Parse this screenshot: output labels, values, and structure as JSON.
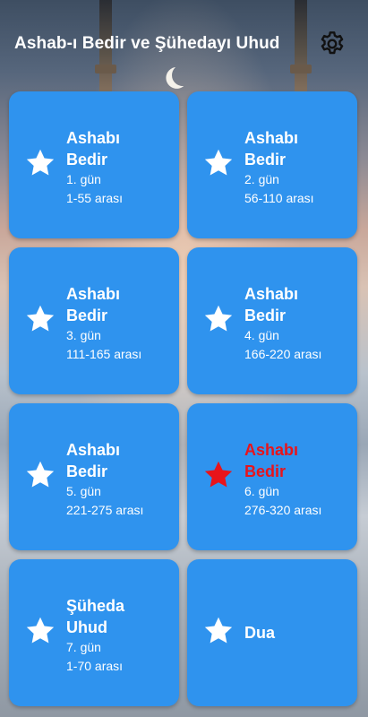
{
  "header": {
    "title": "Ashab-ı Bedir ve Şühedayı Uhud",
    "settings_icon": "gear-icon"
  },
  "colors": {
    "card": "#2f93ee",
    "star_default": "#ffffff",
    "star_active": "#e8141b",
    "text": "#ffffff"
  },
  "cards": [
    {
      "name": "Ashabı\nBedir",
      "day": "1. gün",
      "range": "1-55 arası",
      "icon": "star-icon",
      "active": false
    },
    {
      "name": "Ashabı\nBedir",
      "day": "2. gün",
      "range": "56-110 arası",
      "icon": "star-icon",
      "active": false
    },
    {
      "name": "Ashabı\nBedir",
      "day": "3. gün",
      "range": "111-165 arası",
      "icon": "star-icon",
      "active": false
    },
    {
      "name": "Ashabı\nBedir",
      "day": "4. gün",
      "range": "166-220 arası",
      "icon": "star-icon",
      "active": false
    },
    {
      "name": "Ashabı\nBedir",
      "day": "5. gün",
      "range": "221-275 arası",
      "icon": "star-icon",
      "active": false
    },
    {
      "name": "Ashabı\nBedir",
      "day": "6. gün",
      "range": "276-320 arası",
      "icon": "star-icon",
      "active": true
    },
    {
      "name": "Şüheda\nUhud",
      "day": "7. gün",
      "range": "1-70 arası",
      "icon": "star-icon",
      "active": false
    },
    {
      "name": "Dua",
      "icon": "star-icon",
      "active": false
    }
  ]
}
